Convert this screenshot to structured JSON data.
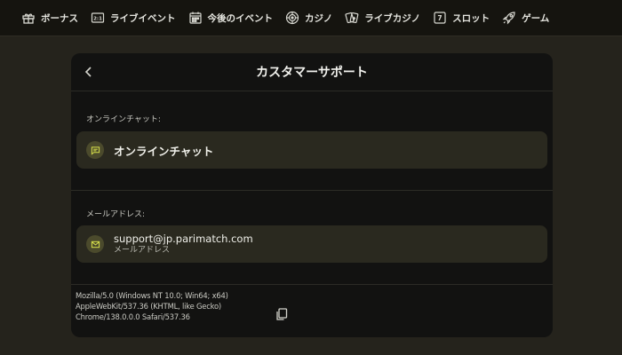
{
  "nav": {
    "items": [
      {
        "label": "ボーナス",
        "icon": "gift-icon"
      },
      {
        "label": "ライブイベント",
        "icon": "live-score-icon"
      },
      {
        "label": "今後のイベント",
        "icon": "calendar-icon"
      },
      {
        "label": "カジノ",
        "icon": "roulette-icon"
      },
      {
        "label": "ライブカジノ",
        "icon": "cards-icon"
      },
      {
        "label": "スロット",
        "icon": "slot-icon"
      },
      {
        "label": "ゲーム",
        "icon": "rocket-icon"
      }
    ]
  },
  "modal": {
    "title": "カスタマーサポート",
    "chat_section": {
      "label": "オンラインチャット:",
      "item_title": "オンラインチャット",
      "icon": "chat-icon"
    },
    "email_section": {
      "label": "メールアドレス:",
      "email": "support@jp.parimatch.com",
      "sublabel": "メールアドレス",
      "icon": "mail-icon"
    },
    "user_agent": {
      "line1": "Mozilla/5.0 (Windows NT 10.0; Win64; x64)",
      "line2": "AppleWebKit/537.36 (KHTML, like Gecko)",
      "line3": "Chrome/138.0.0.0 Safari/537.36"
    }
  },
  "colors": {
    "background": "#25231c",
    "nav_bg": "#15140f",
    "card_bg": "#121211",
    "row_bg": "#2a291f",
    "accent": "#d8e04a"
  }
}
